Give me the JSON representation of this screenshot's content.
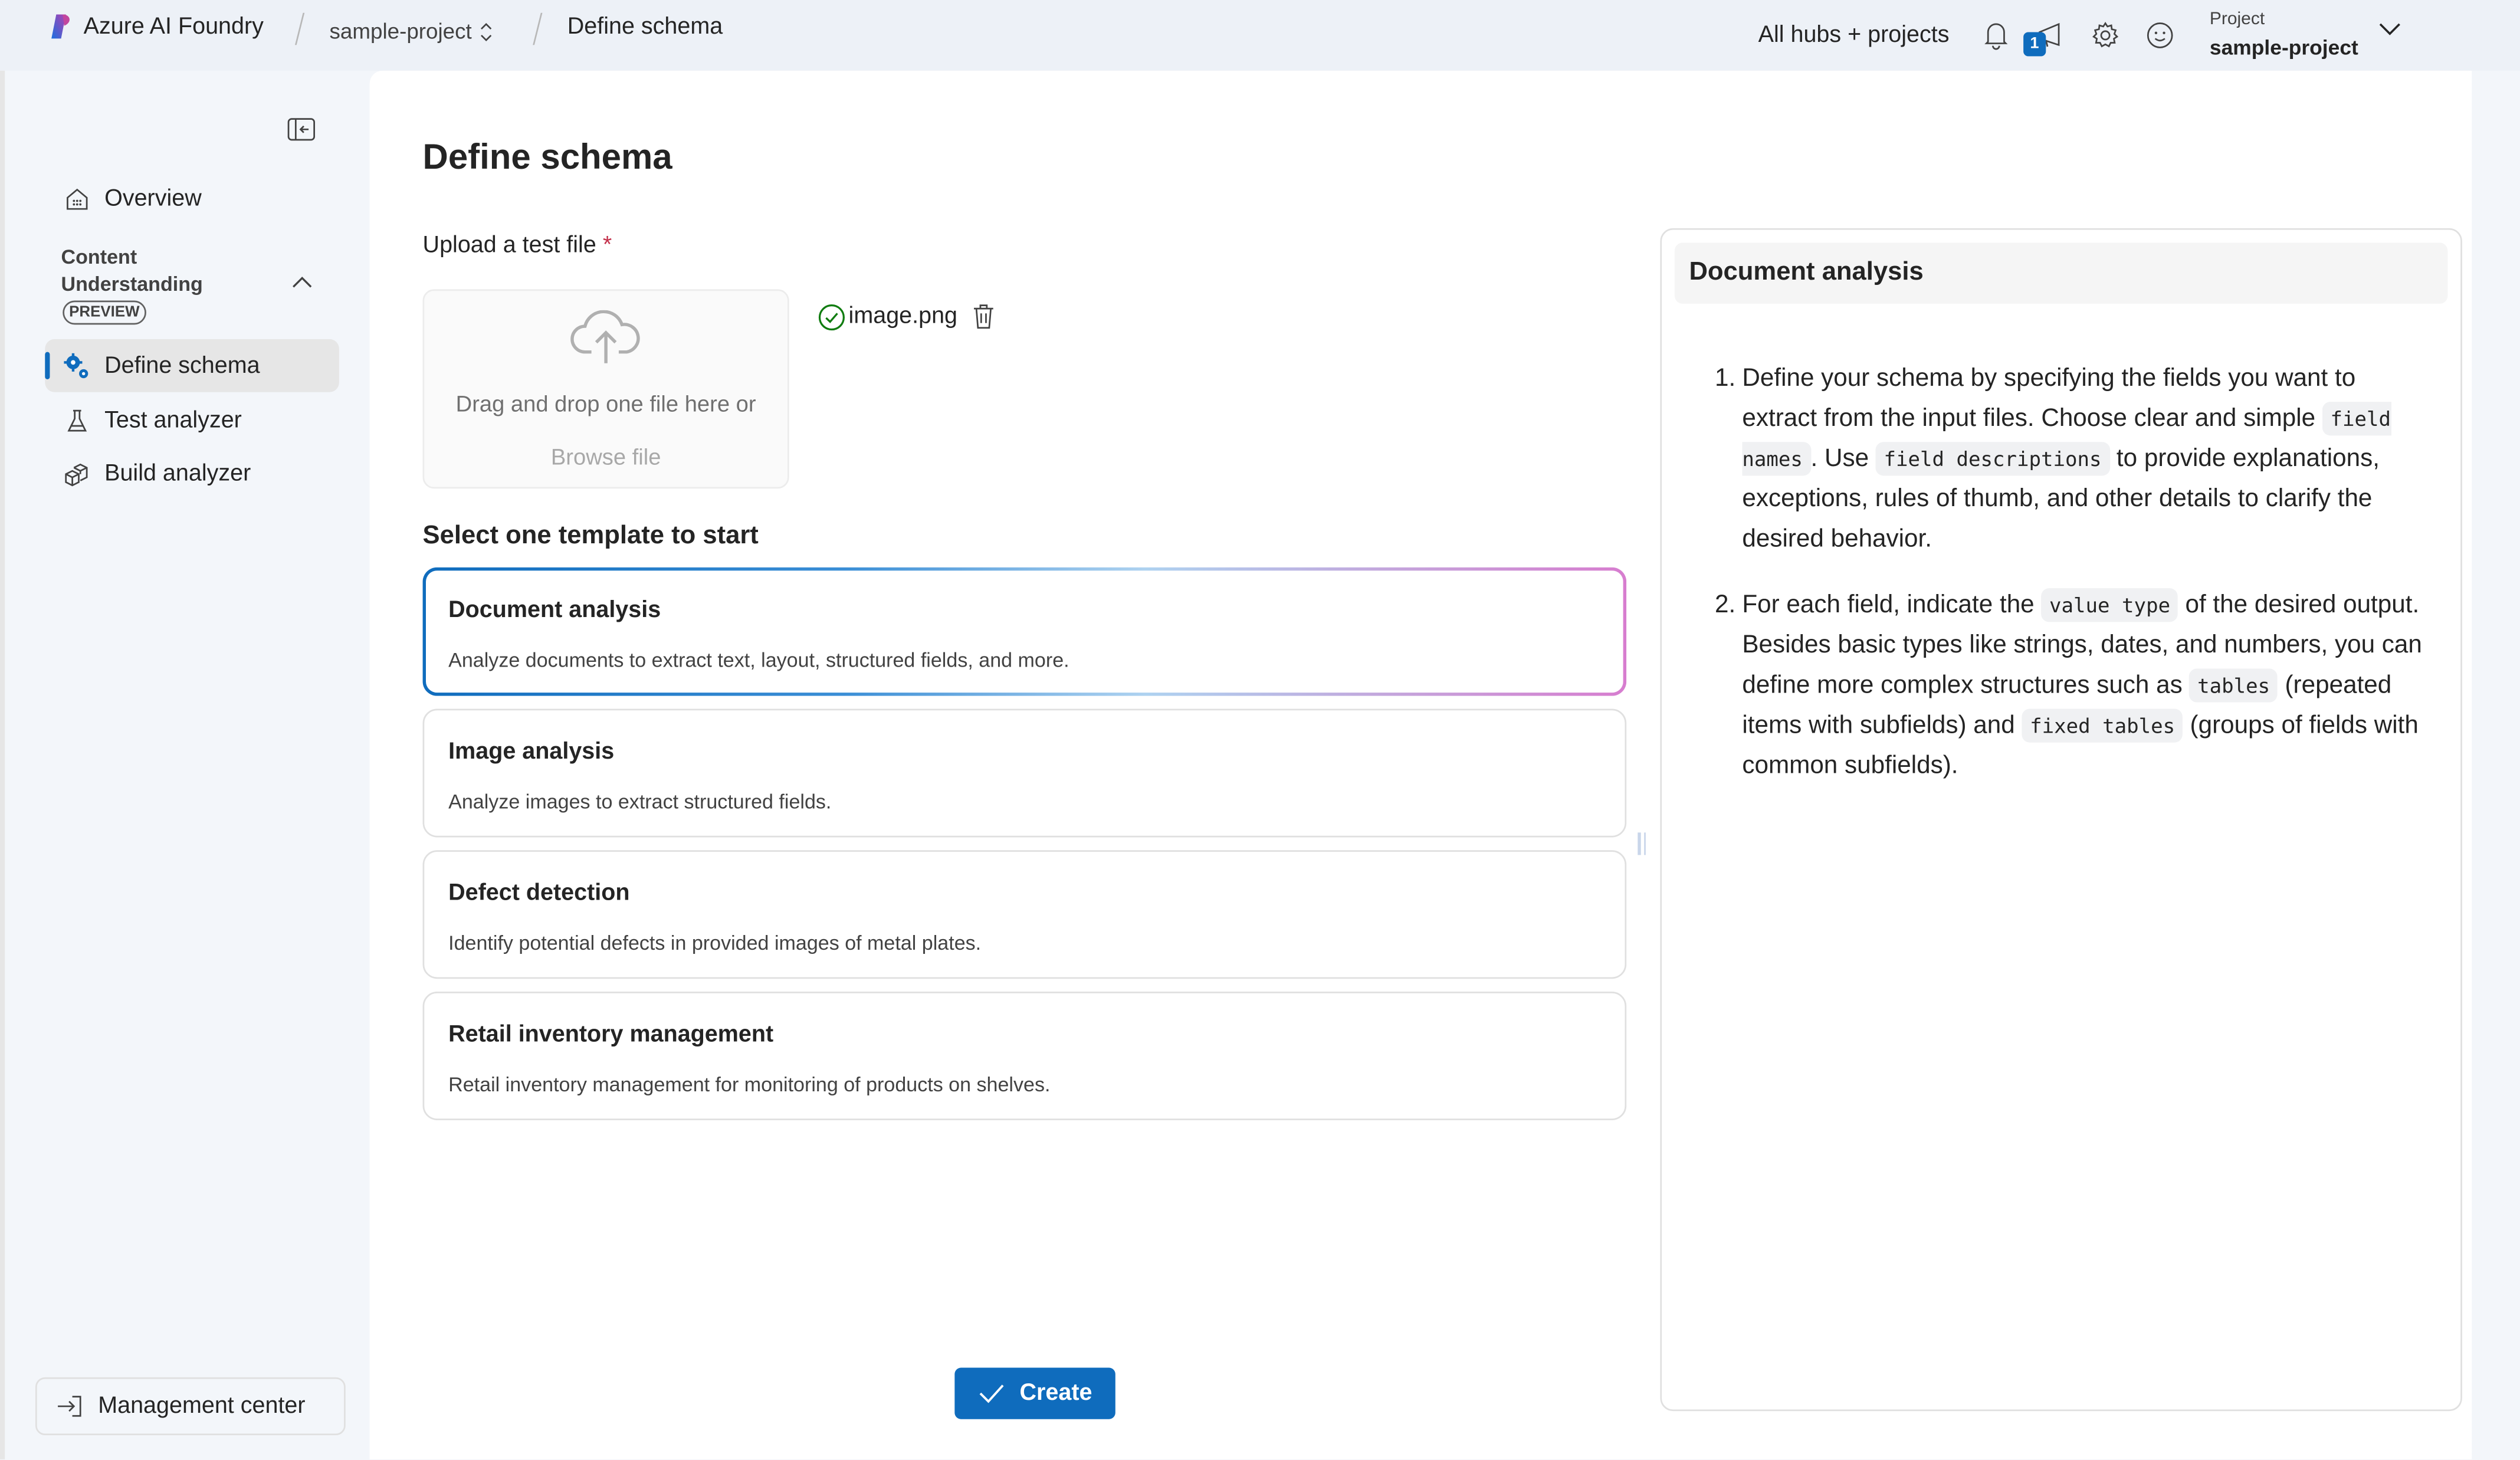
{
  "topbar": {
    "brand": "Azure AI Foundry",
    "project_crumb": "sample-project",
    "current_crumb": "Define schema",
    "hubs_link": "All hubs + projects",
    "notification_badge": "1",
    "project_selector": {
      "label": "Project",
      "value": "sample-project"
    }
  },
  "sidebar": {
    "items": [
      {
        "label": "Overview",
        "icon": "home-grid-icon"
      }
    ],
    "group": {
      "title": "Content Understanding",
      "badge": "PREVIEW",
      "expanded": true,
      "items": [
        {
          "label": "Define schema",
          "icon": "gears-icon",
          "active": true
        },
        {
          "label": "Test analyzer",
          "icon": "beaker-icon",
          "active": false
        },
        {
          "label": "Build analyzer",
          "icon": "cubes-icon",
          "active": false
        }
      ]
    },
    "footer": {
      "label": "Management center"
    }
  },
  "main": {
    "title": "Define schema",
    "upload": {
      "label": "Upload a test file",
      "required_mark": "*",
      "dropzone_text": "Drag and drop one file here or",
      "browse_label": "Browse file",
      "uploaded_file": "image.png"
    },
    "templates_heading": "Select one template to start",
    "templates": [
      {
        "title": "Document analysis",
        "description": "Analyze documents to extract text, layout, structured fields, and more.",
        "selected": true
      },
      {
        "title": "Image analysis",
        "description": "Analyze images to extract structured fields.",
        "selected": false
      },
      {
        "title": "Defect detection",
        "description": "Identify potential defects in provided images of metal plates.",
        "selected": false
      },
      {
        "title": "Retail inventory management",
        "description": "Retail inventory management for monitoring of products on shelves.",
        "selected": false
      }
    ],
    "create_label": "Create"
  },
  "help": {
    "title": "Document analysis",
    "steps": [
      {
        "num": "1.",
        "t1": "Define your schema by specifying the fields you want to extract from the input files. Choose clear and simple ",
        "c1": "field names",
        "t2": ". Use ",
        "c2": "field descriptions",
        "t3": " to provide explanations, exceptions, rules of thumb, and other details to clarify the desired behavior."
      },
      {
        "num": "2.",
        "t1": "For each field, indicate the ",
        "c1": "value type",
        "t2": " of the desired output. Besides basic types like strings, dates, and numbers, you can define more complex structures such as ",
        "c2": "tables",
        "t3": " (repeated items with subfields) and ",
        "c3": "fixed tables",
        "t4": " (groups of fields with common subfields)."
      }
    ]
  },
  "colors": {
    "accent": "#0f6cbd",
    "required": "#c4314b",
    "success": "#107c10",
    "gradient_start": "#0f6cbd",
    "gradient_end": "#d77dcf"
  }
}
